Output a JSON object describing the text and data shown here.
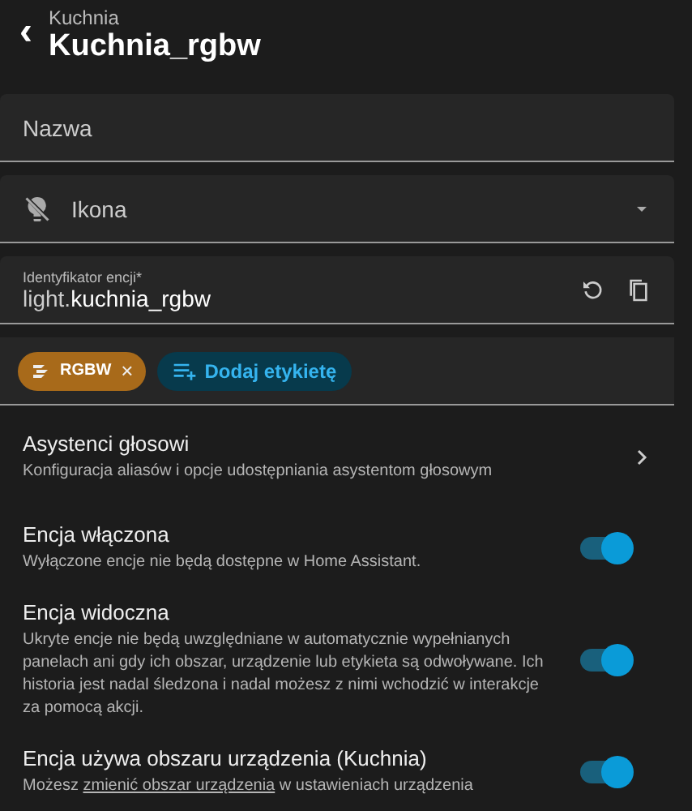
{
  "header": {
    "back": "‹",
    "subtitle": "Kuchnia",
    "title": "Kuchnia_rgbw"
  },
  "fields": [
    {
      "kind": "text",
      "label": "Nazwa"
    },
    {
      "kind": "icon",
      "label": "Ikona"
    },
    {
      "kind": "entity",
      "label": "Identyfikator encji*",
      "prefix": "light.",
      "value": "kuchnia_rgbw"
    }
  ],
  "labels": {
    "chips": [
      {
        "text": "RGBW",
        "color": "#a86a1a",
        "remove": "×"
      }
    ],
    "add": "Dodaj etykietę"
  },
  "settings": [
    {
      "kind": "link",
      "title": "Asystenci głosowi",
      "description": "Konfiguracja aliasów i opcje udostępniania asystentom głosowym"
    },
    {
      "kind": "toggle",
      "title": "Encja włączona",
      "description": "Wyłączone encje nie będą dostępne w Home Assistant.",
      "on": true
    },
    {
      "kind": "toggle",
      "title": "Encja widoczna",
      "description": "Ukryte encje nie będą uwzględniane w automatycznie wypełnianych panelach ani gdy ich obszar, urządzenie lub etykieta są odwoływane. Ich historia jest nadal śledzona i nadal możesz z nimi wchodzić w interakcje za pomocą akcji.",
      "on": true
    },
    {
      "kind": "toggle",
      "title": "Encja używa obszaru urządzenia (Kuchnia)",
      "description": "Możesz",
      "link": "zmienić obszar urządzenia",
      "description_after": "w ustawieniach urządzenia",
      "on": true
    }
  ]
}
